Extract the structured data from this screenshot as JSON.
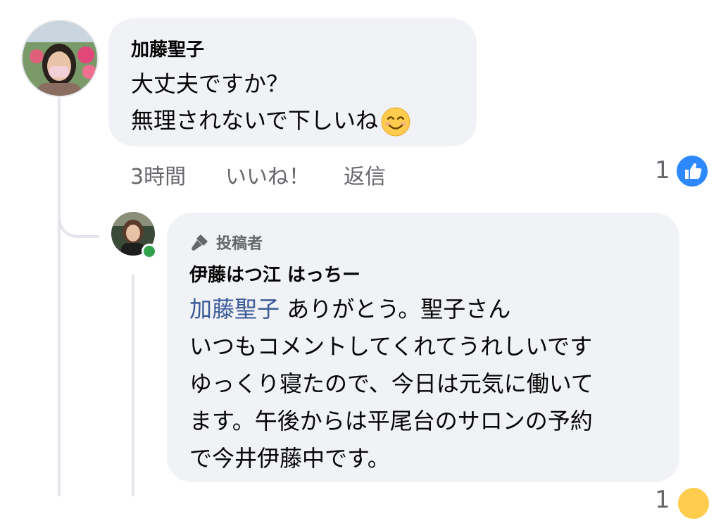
{
  "comments": [
    {
      "author": "加藤聖子",
      "lines": [
        "大丈夫ですか？",
        "無理されないで下しいね"
      ],
      "emoji": "😊",
      "time": "3時間",
      "like_label": "いいね！",
      "reply_label": "返信",
      "reaction_count": "1"
    },
    {
      "badge": "投稿者",
      "author": "伊藤はつ江 はっちー",
      "mention": "加藤聖子",
      "first_line_rest": " ありがとう。聖子さん",
      "lines": [
        "いつもコメントしてくれてうれしいです",
        "ゆっくり寝たので、今日は元気に働いて",
        "ます。午後からは平尾台のサロンの予約",
        "で今井伊藤中です。"
      ],
      "reaction_count": "1"
    }
  ],
  "colors": {
    "bubble": "#f0f2f5",
    "mention": "#385898",
    "like_blue": "#2e89ff",
    "online": "#31a24c"
  }
}
